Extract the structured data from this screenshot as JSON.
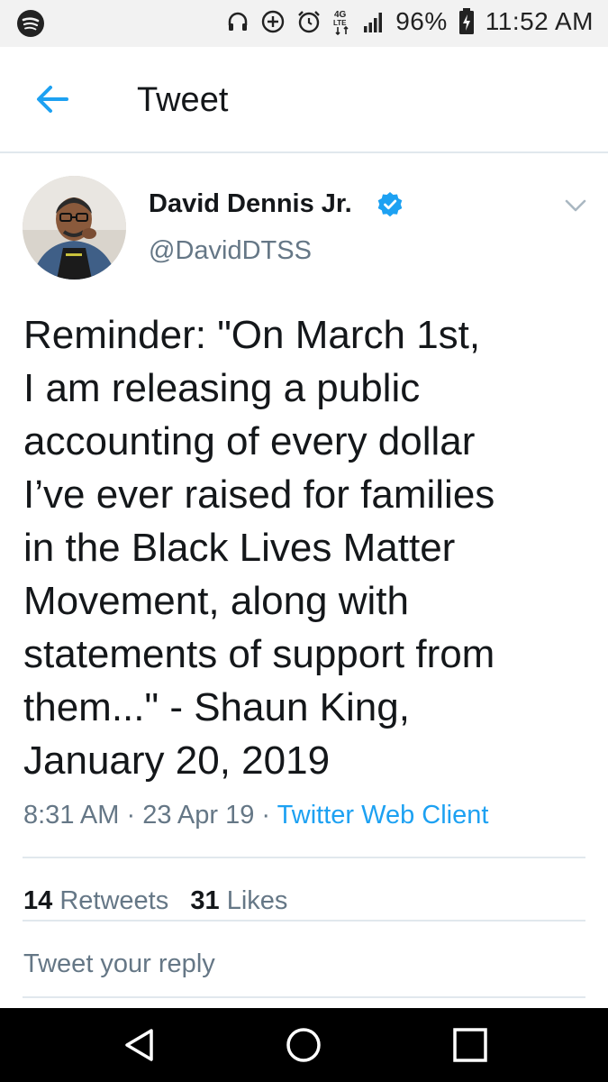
{
  "status_bar": {
    "battery_percent": "96%",
    "time": "11:52 AM",
    "network": "4G LTE",
    "icons": [
      "spotify-icon",
      "headphones-icon",
      "data-saver-icon",
      "alarm-icon",
      "network-4g-icon",
      "signal-icon",
      "battery-charging-icon"
    ]
  },
  "header": {
    "title": "Tweet",
    "back_icon": "arrow-left-icon"
  },
  "tweet": {
    "author_name": "David Dennis Jr.",
    "handle": "@DavidDTSS",
    "verified": true,
    "text_lines": [
      "Reminder: \"On March 1st,",
      "I am releasing a public",
      "accounting of every dollar",
      "I’ve ever raised for families",
      "in the Black Lives Matter",
      "Movement, along with",
      "statements of support from",
      "them...\" - Shaun King,",
      "January 20, 2019"
    ],
    "time": "8:31 AM",
    "date": "23 Apr 19",
    "separator": "·",
    "client": "Twitter Web Client"
  },
  "stats": {
    "retweets_count": "14",
    "retweets_label": "Retweets",
    "likes_count": "31",
    "likes_label": "Likes"
  },
  "reply": {
    "placeholder": "Tweet your reply"
  },
  "colors": {
    "accent": "#1da1f2",
    "secondary_text": "#657786",
    "primary_text": "#14171a",
    "divider": "#e1e8ed"
  }
}
